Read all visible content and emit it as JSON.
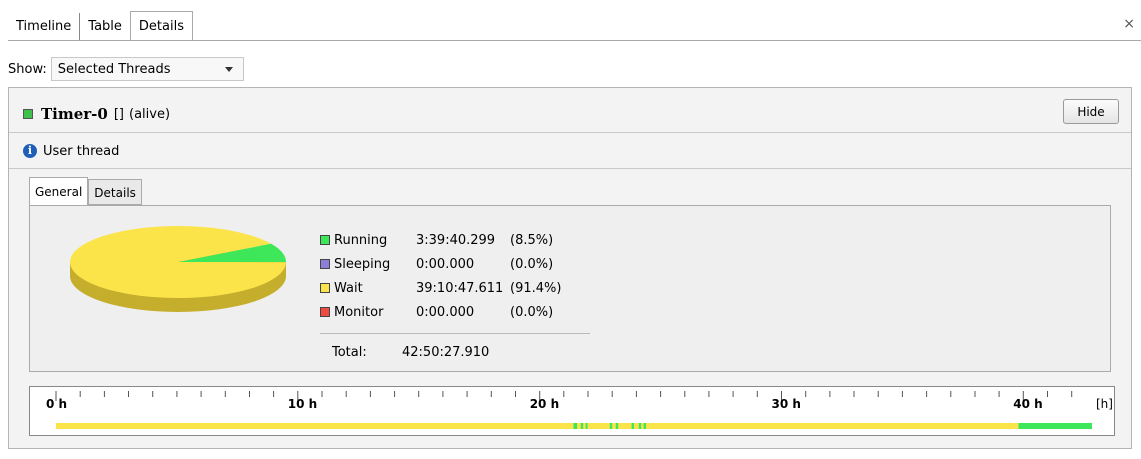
{
  "window": {
    "tabs": [
      {
        "label": "Timeline",
        "active": false
      },
      {
        "label": "Table",
        "active": false
      },
      {
        "label": "Details",
        "active": true
      }
    ],
    "close_icon": "×"
  },
  "show": {
    "label": "Show:",
    "selected": "Selected Threads"
  },
  "thread": {
    "name": "Timer-0",
    "brackets": "[]",
    "state": "(alive)",
    "status_color": "#3fbf4e",
    "hide_label": "Hide",
    "info_icon": "info-icon",
    "info_text": "User thread"
  },
  "inner_tabs": [
    {
      "label": "General",
      "active": true
    },
    {
      "label": "Details",
      "active": false
    }
  ],
  "stats": [
    {
      "name": "Running",
      "time": "3:39:40.299",
      "pct": "(8.5%)",
      "color": "#3ee65a",
      "fraction": 0.085
    },
    {
      "name": "Sleeping",
      "time": "0:00.000",
      "pct": "(0.0%)",
      "color": "#8c7fd9",
      "fraction": 0.0
    },
    {
      "name": "Wait",
      "time": "39:10:47.611",
      "pct": "(91.4%)",
      "color": "#fae44a",
      "fraction": 0.914
    },
    {
      "name": "Monitor",
      "time": "0:00.000",
      "pct": "(0.0%)",
      "color": "#ee4b43",
      "fraction": 0.0
    }
  ],
  "total": {
    "label": "Total:",
    "time": "42:50:27.910"
  },
  "timeline": {
    "ticks": [
      "0 h",
      "10 h",
      "20 h",
      "30 h",
      "40 h"
    ],
    "unit": "[h]",
    "max_hours": 42.84,
    "wait_color": "#fae44a",
    "run_color": "#3ee65a",
    "run_segments": [
      [
        21.4,
        21.55
      ],
      [
        21.7,
        21.8
      ],
      [
        21.9,
        21.98
      ],
      [
        22.9,
        23.0
      ],
      [
        23.15,
        23.25
      ],
      [
        23.8,
        23.9
      ],
      [
        24.1,
        24.2
      ],
      [
        24.3,
        24.4
      ],
      [
        39.8,
        42.84
      ]
    ]
  }
}
